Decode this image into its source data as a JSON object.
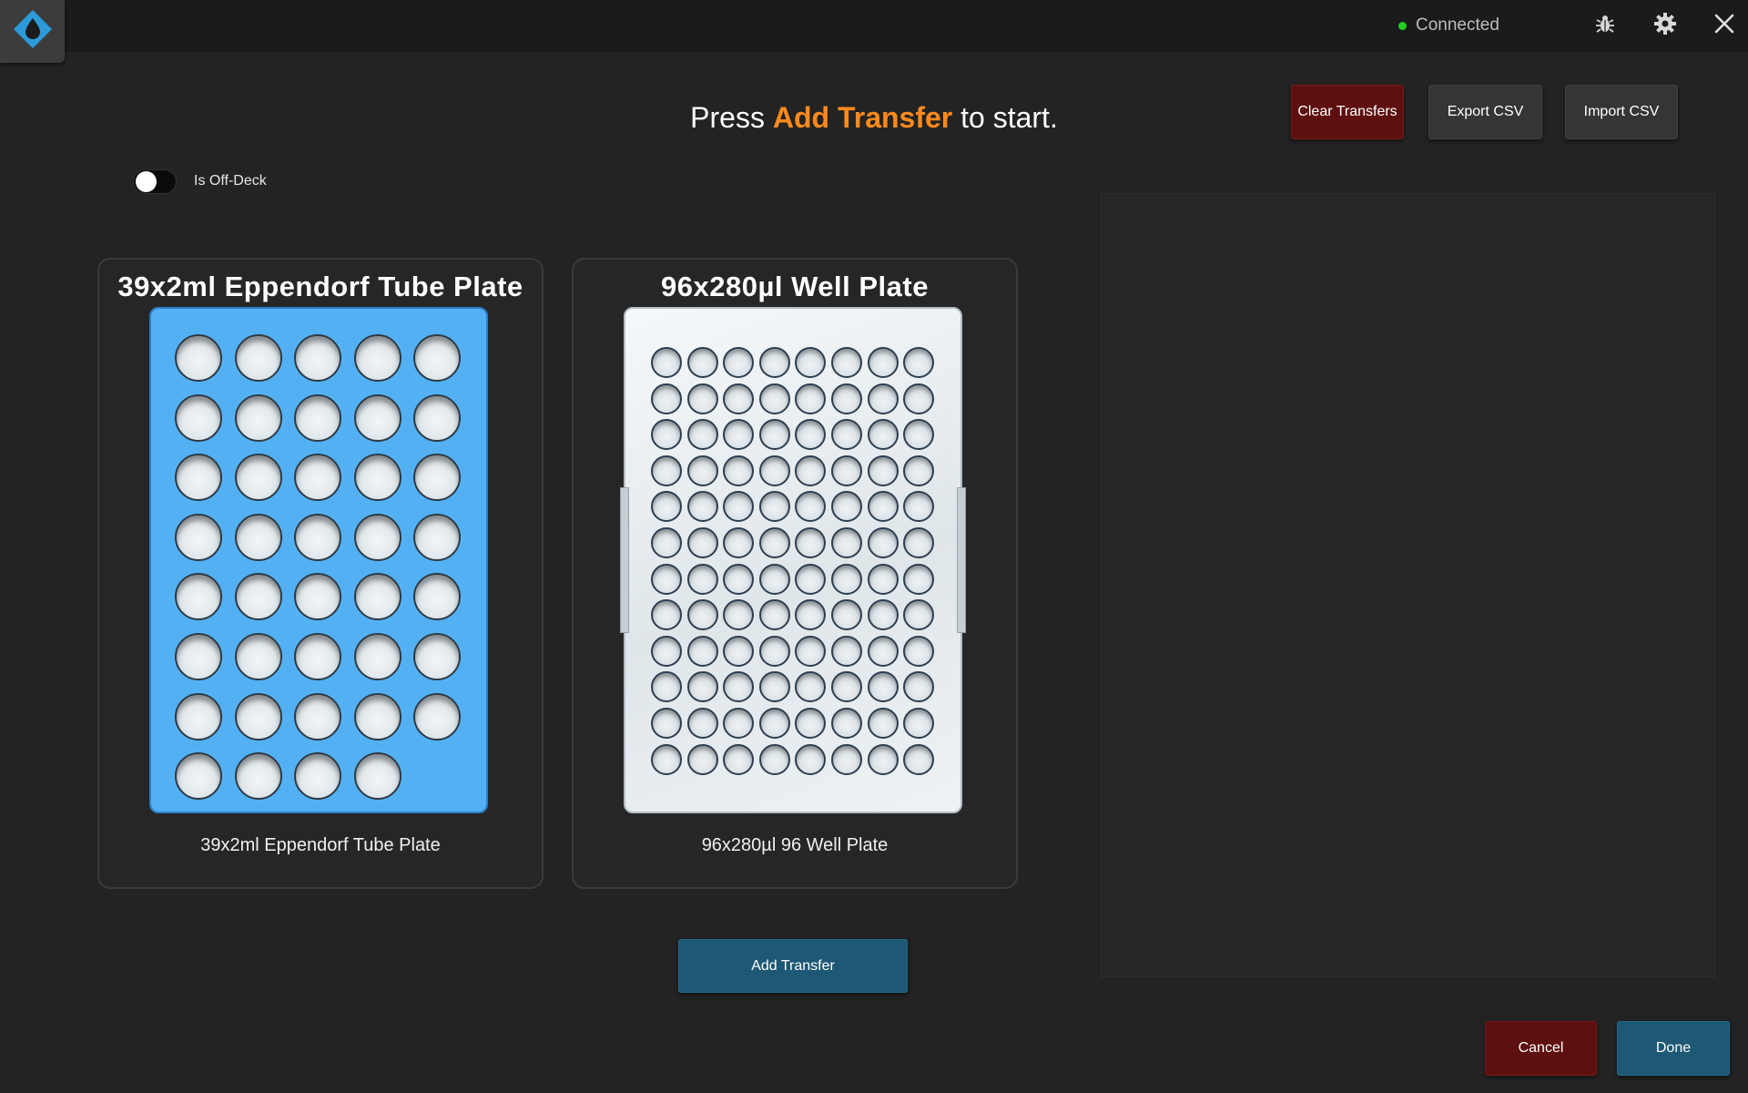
{
  "header": {
    "status_text": "Connected",
    "status_color": "#22d022",
    "logo_icon": "droplet-icon",
    "icons": [
      "bug-icon",
      "gear-icon",
      "close-icon"
    ]
  },
  "instruction": {
    "prefix": "Press ",
    "highlight": "Add Transfer",
    "suffix": " to start.",
    "highlight_color": "#ff8a1c"
  },
  "toolbar": {
    "clear_label": "Clear Transfers",
    "export_label": "Export CSV",
    "import_label": "Import CSV"
  },
  "off_deck": {
    "label": "Is Off-Deck",
    "checked": false
  },
  "labware": [
    {
      "title": "39x2ml Eppendorf Tube Plate",
      "caption": "39x2ml Eppendorf Tube Plate",
      "columns": 5,
      "rows": 8,
      "wells": 39,
      "color": "#53b1f3"
    },
    {
      "title": "96x280µl Well Plate",
      "caption": "96x280µl 96 Well Plate",
      "columns": 8,
      "rows": 12,
      "wells": 96,
      "color": "#eef2f5"
    }
  ],
  "actions": {
    "add_transfer_label": "Add Transfer",
    "cancel_label": "Cancel",
    "done_label": "Done"
  }
}
